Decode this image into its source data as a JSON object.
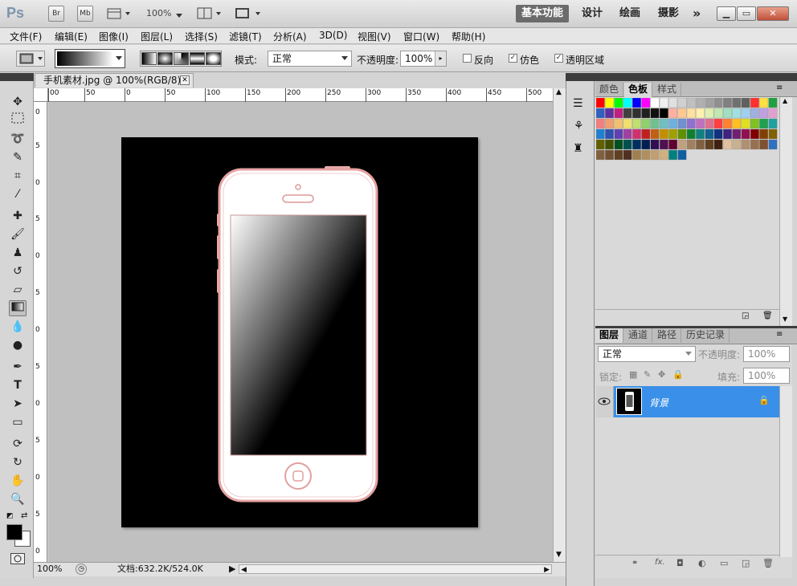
{
  "app": {
    "logo": "Ps",
    "bridge_btn": "Br",
    "minibridge_btn": "Mb",
    "zoom": "100%",
    "workspace_active": "基本功能",
    "workspaces": [
      "设计",
      "绘画",
      "摄影"
    ],
    "more": "»"
  },
  "menu": [
    "文件(F)",
    "编辑(E)",
    "图像(I)",
    "图层(L)",
    "选择(S)",
    "滤镜(T)",
    "分析(A)",
    "3D(D)",
    "视图(V)",
    "窗口(W)",
    "帮助(H)"
  ],
  "options": {
    "mode_label": "模式:",
    "mode_value": "正常",
    "opacity_label": "不透明度:",
    "opacity_value": "100%",
    "reverse": "反向",
    "dither": "仿色",
    "transparency": "透明区域"
  },
  "document": {
    "tab_title": "手机素材.jpg @ 100%(RGB/8) *",
    "status_zoom": "100%",
    "doc_size": "文档:632.2K/524.0K"
  },
  "ruler_h": [
    "00",
    "50",
    "0",
    "50",
    "100",
    "150",
    "200",
    "250",
    "300",
    "350",
    "400",
    "450",
    "500"
  ],
  "ruler_v": [
    "0",
    "5",
    "0",
    "5",
    "0",
    "5",
    "0",
    "5",
    "0",
    "5",
    "0",
    "5",
    "0"
  ],
  "swatch_tabs": [
    "颜色",
    "色板",
    "样式"
  ],
  "layers": {
    "tabs": [
      "图层",
      "通道",
      "路径",
      "历史记录"
    ],
    "blend": "正常",
    "opacity_label": "不透明度:",
    "opacity": "100%",
    "lock_label": "锁定:",
    "fill_label": "填充:",
    "fill": "100%",
    "layer_name": "背景"
  },
  "colors": {
    "canvas_bg": "#000000",
    "selection": "#3a8fe8",
    "phone_frame": "#e6a3a3"
  }
}
